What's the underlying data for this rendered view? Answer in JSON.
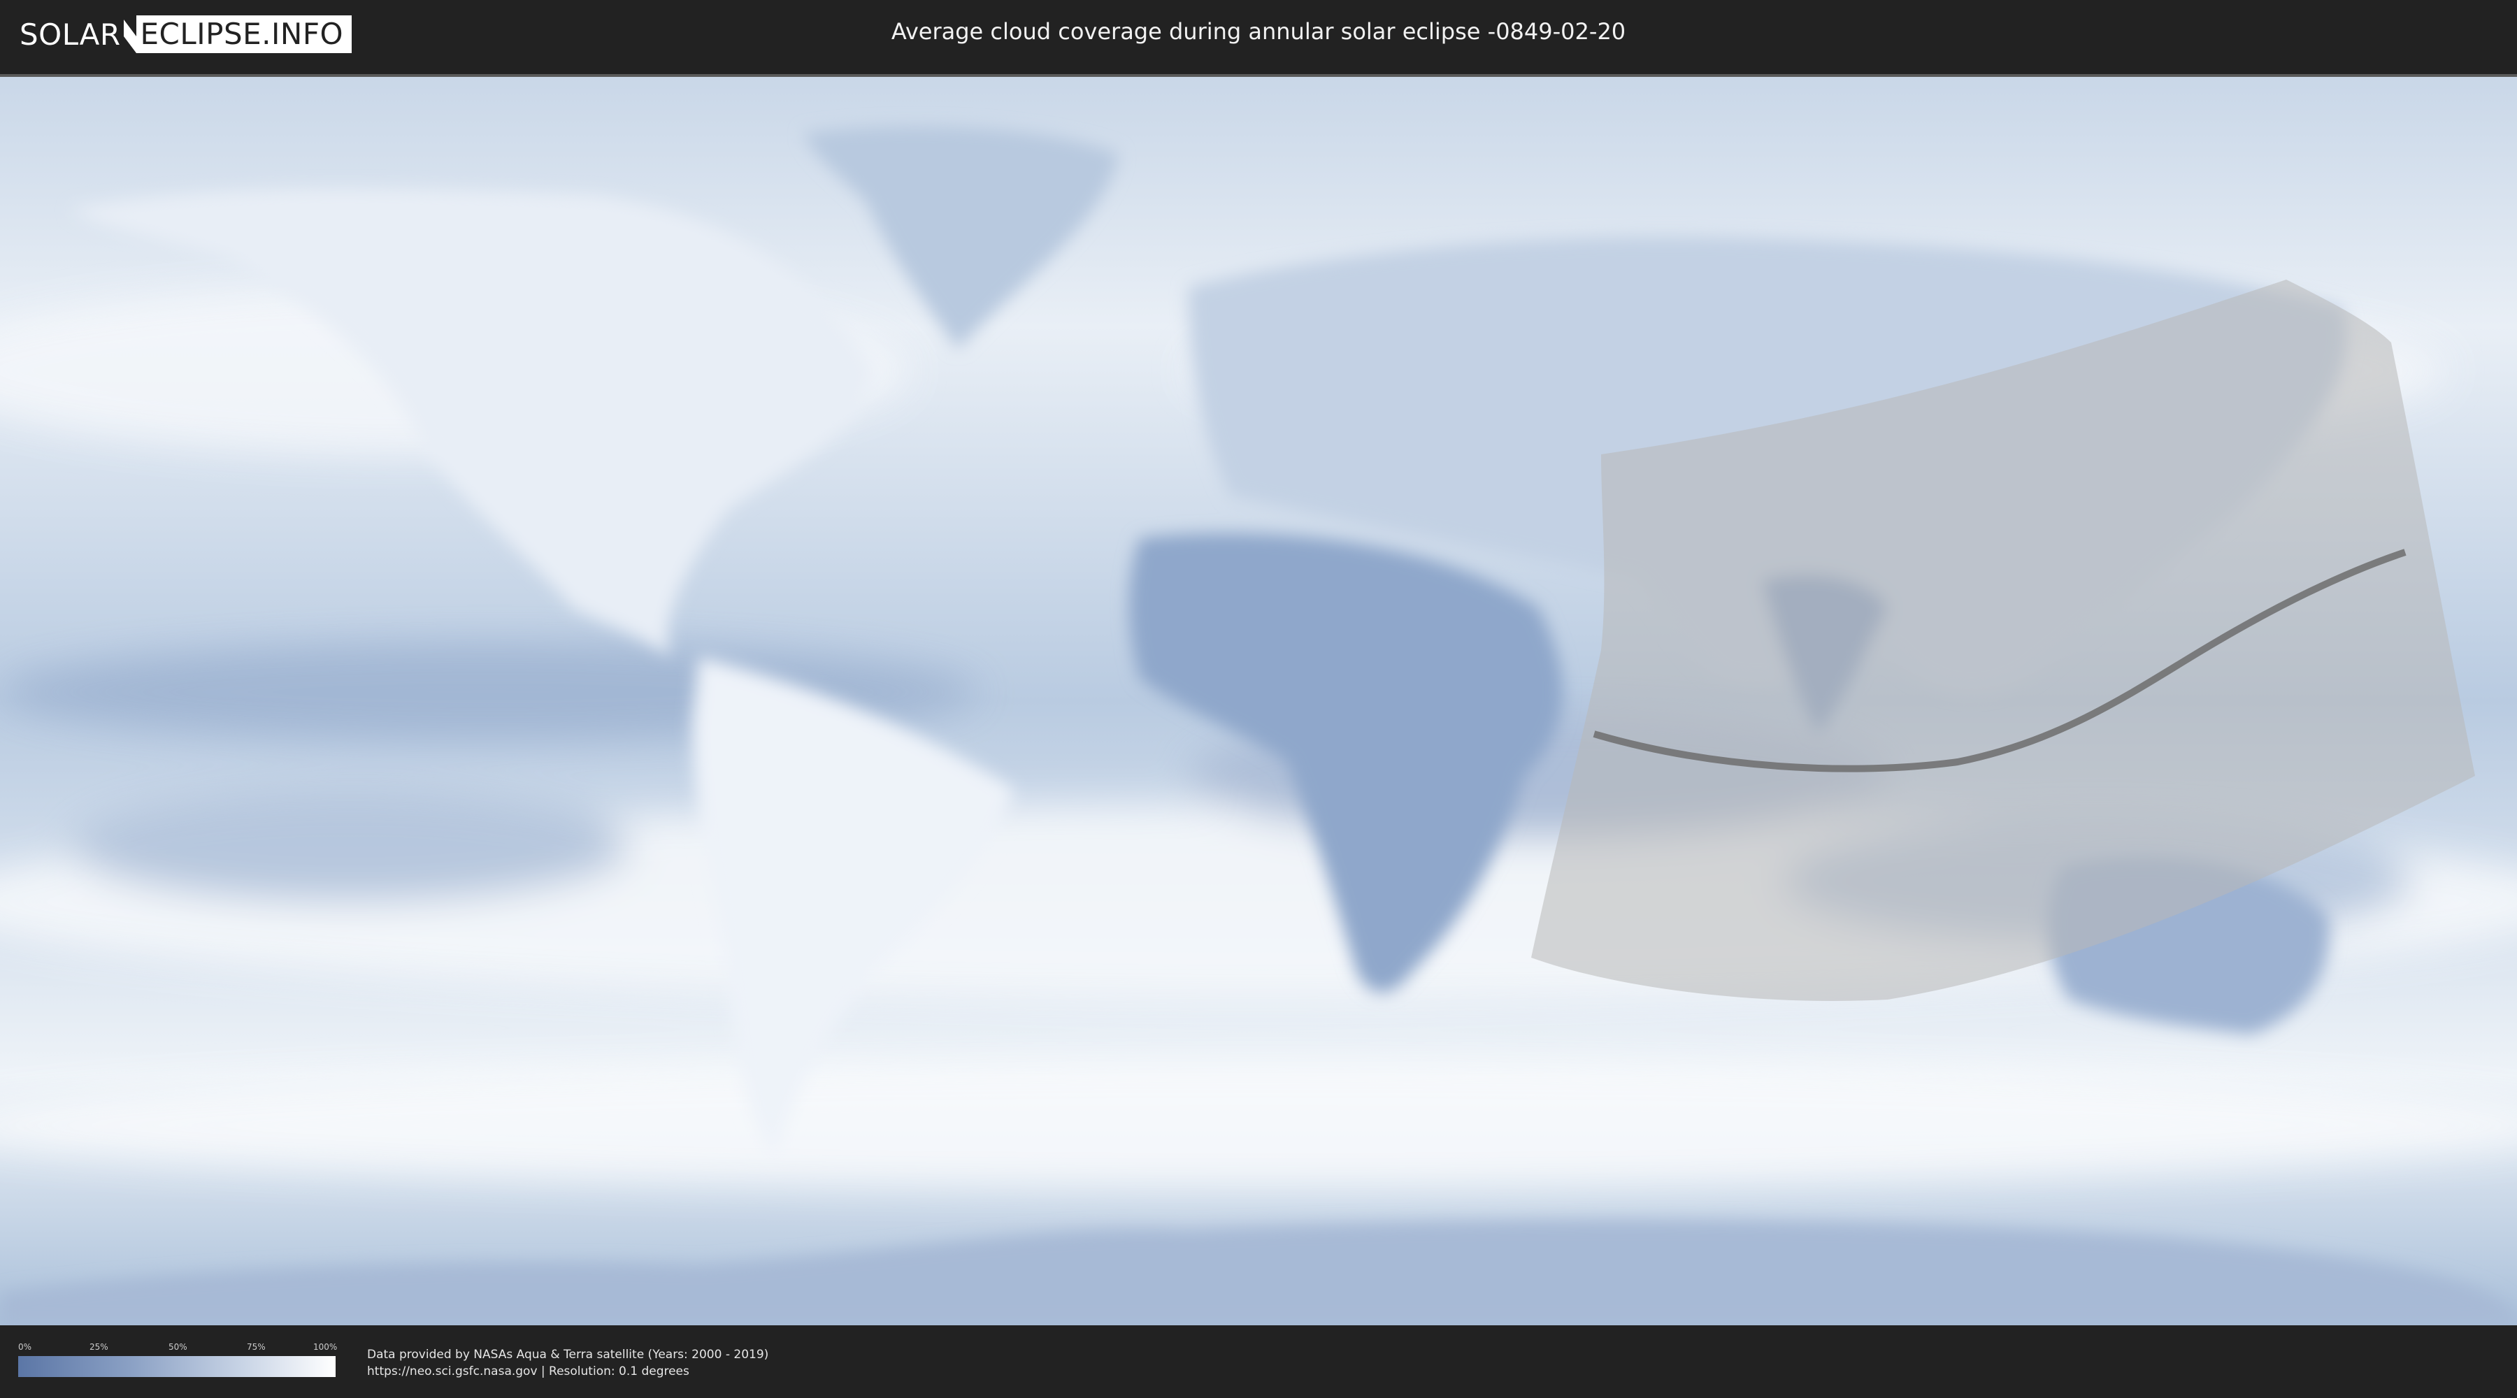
{
  "header": {
    "logo_left": "SOLAR",
    "logo_right": "ECLIPSE.INFO",
    "title": "Average cloud coverage during annular solar eclipse -0849-02-20"
  },
  "legend": {
    "ticks": [
      "0%",
      "25%",
      "50%",
      "75%",
      "100%"
    ],
    "colors": {
      "low": "#5b76a6",
      "high": "#ffffff"
    }
  },
  "credits": {
    "line1": "Data provided by NASAs Aqua & Terra satellite (Years: 2000 - 2019)",
    "line2": "https://neo.sci.gsfc.nasa.gov | Resolution: 0.1 degrees"
  },
  "map": {
    "eclipse_region_color": "#b8b8b8",
    "central_line_color": "#6d6d6d"
  }
}
